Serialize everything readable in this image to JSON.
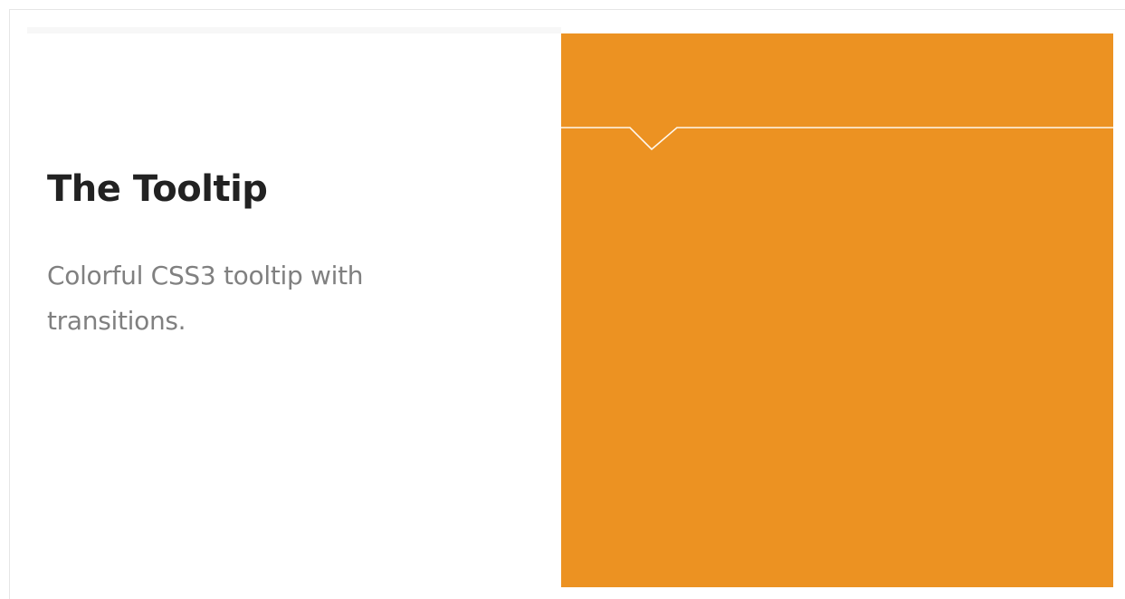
{
  "card": {
    "title": "The Tooltip",
    "description": "Colorful CSS3 tooltip with transitions."
  },
  "demo": {
    "background_color": "#EC9222",
    "line_color": "#FFF7EC",
    "pointer": "down-pointing notch on a horizontal line"
  },
  "colors": {
    "title": "#222222",
    "description": "#808080",
    "page_background": "#FFFFFF"
  }
}
